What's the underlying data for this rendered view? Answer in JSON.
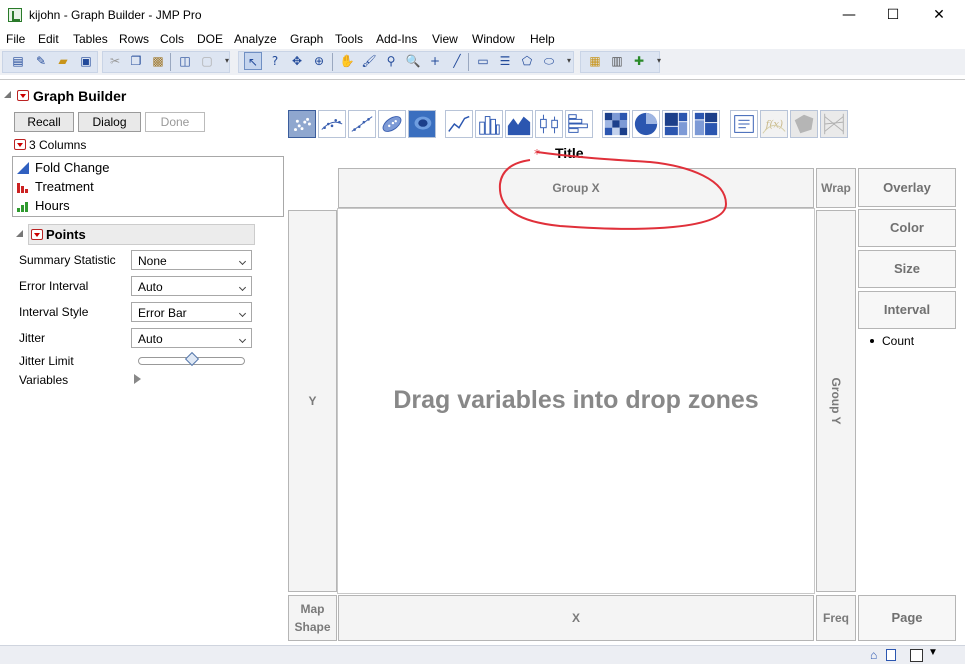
{
  "window": {
    "title": "kijohn - Graph Builder - JMP Pro",
    "minimize": "—",
    "maximize": "☐",
    "close": "✕"
  },
  "menu": [
    "File",
    "Edit",
    "Tables",
    "Rows",
    "Cols",
    "DOE",
    "Analyze",
    "Graph",
    "Tools",
    "Add-Ins",
    "View",
    "Window",
    "Help"
  ],
  "report": {
    "title": "Graph Builder",
    "buttons": {
      "recall": "Recall",
      "dialog": "Dialog",
      "done": "Done"
    },
    "columns_header": "3 Columns",
    "columns": [
      {
        "name": "Fold Change",
        "icon": "continuous-icon"
      },
      {
        "name": "Treatment",
        "icon": "nominal-icon"
      },
      {
        "name": "Hours",
        "icon": "ordinal-icon"
      }
    ],
    "points_header": "Points",
    "settings": [
      {
        "label": "Summary Statistic",
        "value": "None"
      },
      {
        "label": "Error Interval",
        "value": "Auto"
      },
      {
        "label": "Interval Style",
        "value": "Error Bar"
      },
      {
        "label": "Jitter",
        "value": "Auto"
      }
    ],
    "jitter_limit": {
      "label": "Jitter Limit",
      "value": 0.5
    },
    "variables_label": "Variables"
  },
  "graph": {
    "title": "Title",
    "zones": {
      "group_x": "Group X",
      "wrap": "Wrap",
      "overlay": "Overlay",
      "color": "Color",
      "size": "Size",
      "interval": "Interval",
      "y": "Y",
      "group_y": "Group Y",
      "x": "X",
      "map_shape_line1": "Map",
      "map_shape_line2": "Shape",
      "freq": "Freq",
      "page": "Page"
    },
    "placeholder": "Drag variables into drop zones",
    "legend_item": "Count",
    "annotation_color": "#e0303a"
  }
}
